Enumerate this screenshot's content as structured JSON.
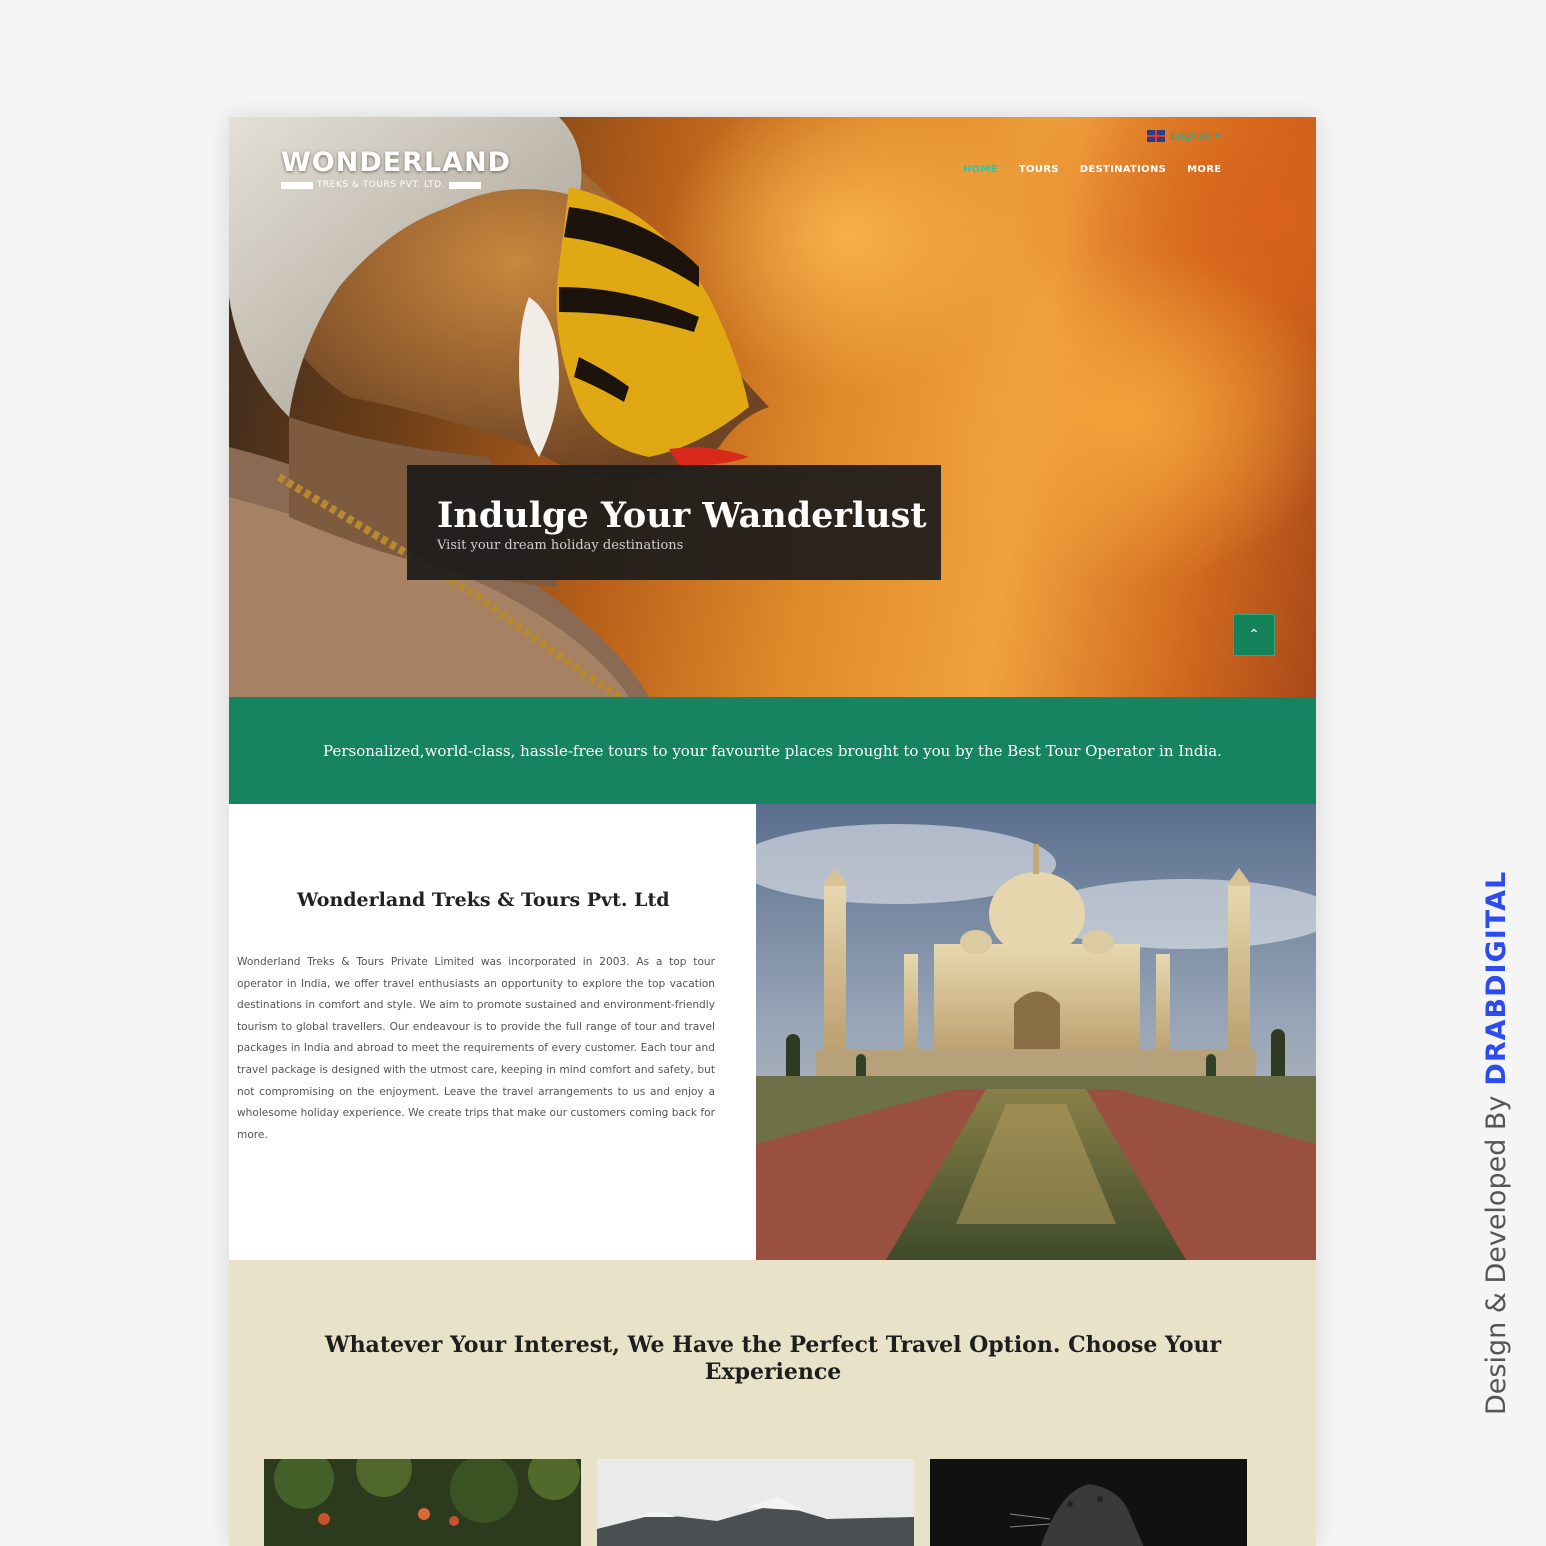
{
  "header": {
    "logo_name": "WONDERLAND",
    "logo_tagline": "TREKS & TOURS PVT. LTD.",
    "language": "English",
    "nav": [
      {
        "label": "HOME",
        "active": true
      },
      {
        "label": "TOURS",
        "active": false
      },
      {
        "label": "DESTINATIONS",
        "active": false
      },
      {
        "label": "MORE",
        "active": false
      }
    ]
  },
  "hero": {
    "title": "Indulge Your Wanderlust",
    "subtitle": "Visit your dream holiday destinations",
    "scroll_top_icon": "chevron-up-icon"
  },
  "band": {
    "text": "Personalized,world-class, hassle-free tours to your favourite places brought to you by the Best Tour Operator in India."
  },
  "about": {
    "title": "Wonderland Treks & Tours Pvt. Ltd",
    "body": "Wonderland Treks & Tours Private Limited was incorporated in 2003. As a top tour operator in India, we offer travel enthusiasts an opportunity to explore the top vacation destinations in comfort and style. We aim to promote sustained and environment-friendly tourism to global travellers. Our endeavour is to provide the full range of tour and travel packages in India and abroad to meet the requirements of every customer. Each tour and travel package is designed with the utmost care, keeping in mind comfort and safety, but not compromising on the enjoyment. Leave the travel arrangements to us and enjoy a wholesome holiday experience. We create trips that make our customers coming back for more."
  },
  "interest": {
    "title": "Whatever Your Interest, We Have the Perfect Travel Option. Choose Your Experience"
  },
  "credit": {
    "label": "Design & Developed By",
    "brand": "DRABDIGITAL"
  },
  "colors": {
    "accent_green": "#168460",
    "nav_active": "#2fc6a8",
    "interest_bg": "#e7e2c8",
    "credit_brand": "#2c4cf0"
  }
}
